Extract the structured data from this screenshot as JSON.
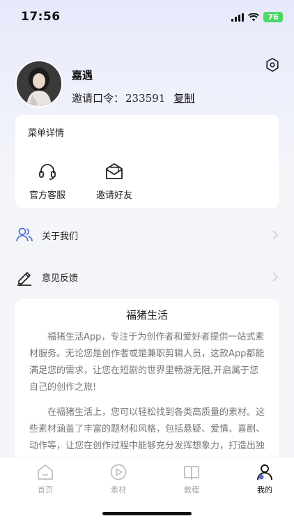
{
  "status": {
    "time": "17:56",
    "battery": "76"
  },
  "profile": {
    "name": "嘉遇",
    "invite_label": "邀请口令：",
    "invite_code": "233591",
    "copy_label": "复制"
  },
  "menu": {
    "title": "菜单详情",
    "items": [
      {
        "label": "官方客服",
        "icon": "headset-icon"
      },
      {
        "label": "邀请好友",
        "icon": "mail-invite-icon"
      }
    ]
  },
  "list": [
    {
      "label": "关于我们",
      "icon": "users-icon"
    },
    {
      "label": "意见反馈",
      "icon": "pencil-icon"
    }
  ],
  "about": {
    "title": "福猪生活",
    "paragraphs": [
      "福猪生活App，专注于为创作者和爱好者提供一站式素材服务。无论您是创作者或是兼职剪辑人员，这款App都能满足您的需求，让您在短剧的世界里畅游无阻,开启属于您自己的创作之旅!",
      "在福猪生活上，您可以轻松找到各类高质量的素材。这些素材涵盖了丰富的题材和风格，包括悬疑、爱情、喜剧、动作等，让您在创作过程中能够充分发挥想象力，打造出独具匠心的短剧作品。同时，我们还不断更新素材"
    ]
  },
  "tabs": [
    {
      "label": "首页",
      "active": false
    },
    {
      "label": "素材",
      "active": false
    },
    {
      "label": "教程",
      "active": false
    },
    {
      "label": "我的",
      "active": true
    }
  ],
  "colors": {
    "accent": "#5b6bd8",
    "battery": "#4cd964",
    "icon_blue": "#4a6fd6"
  }
}
